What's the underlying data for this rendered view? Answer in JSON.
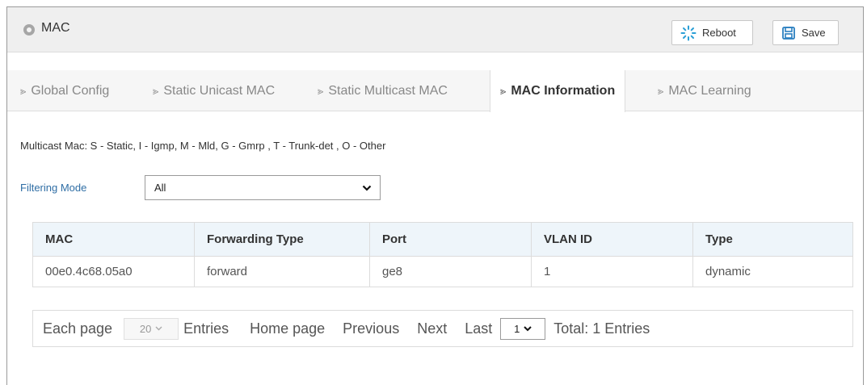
{
  "header": {
    "title": "MAC",
    "reboot_label": "Reboot",
    "save_label": "Save"
  },
  "tabs": [
    {
      "label": "Global Config",
      "active": false
    },
    {
      "label": "Static Unicast MAC",
      "active": false
    },
    {
      "label": "Static Multicast MAC",
      "active": false
    },
    {
      "label": "MAC Information",
      "active": true
    },
    {
      "label": "MAC Learning",
      "active": false
    }
  ],
  "legend": "Multicast Mac: S - Static, I - Igmp, M - Mld, G - Gmrp , T - Trunk-det , O - Other",
  "filter": {
    "label": "Filtering Mode",
    "value": "All"
  },
  "table": {
    "columns": [
      "MAC",
      "Forwarding Type",
      "Port",
      "VLAN ID",
      "Type"
    ],
    "rows": [
      [
        "00e0.4c68.05a0",
        "forward",
        "ge8",
        "1",
        "dynamic"
      ]
    ]
  },
  "pagination": {
    "each_page_label": "Each page",
    "page_size": "20",
    "entries_label": "Entries",
    "home_label": "Home page",
    "previous_label": "Previous",
    "next_label": "Next",
    "last_label": "Last",
    "current_page": "1",
    "total_label": "Total: 1 Entries"
  },
  "colors": {
    "accent_blue": "#2f6ea5",
    "table_header_bg": "#eef5fa",
    "reboot_icon": "#2a9fd6",
    "save_icon": "#2a7fc0"
  }
}
